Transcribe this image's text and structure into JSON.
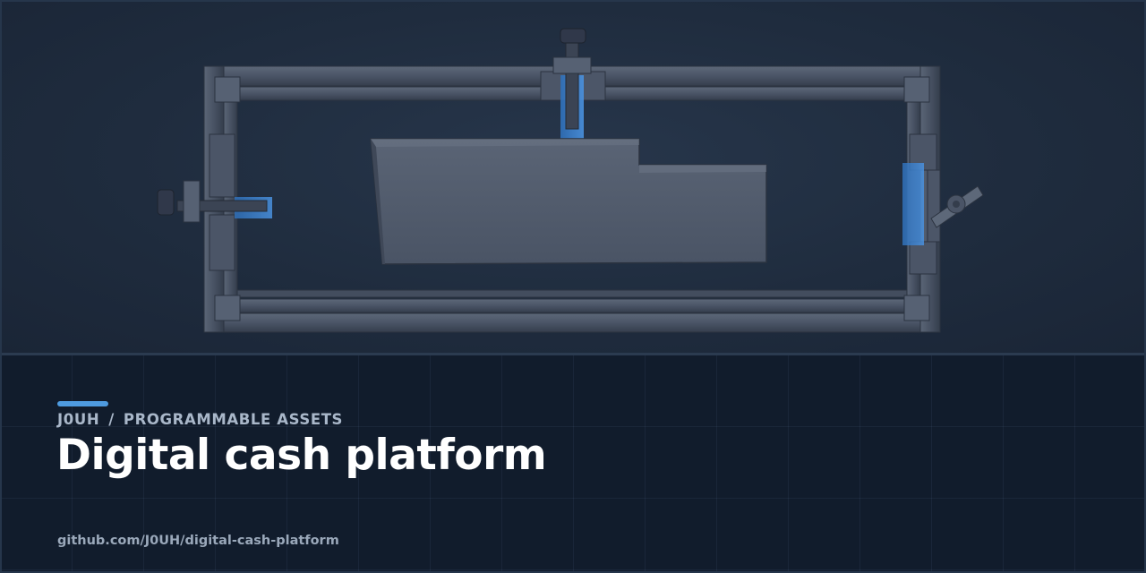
{
  "hero": {
    "illustration": "adjustable-clamp-frame-holding-block",
    "colors": {
      "metal": "#4a5566",
      "highlight": "#4e9be0",
      "background": "#1f2c3e"
    }
  },
  "repo": {
    "owner": "J0UH",
    "separator": "/",
    "topic": "PROGRAMMABLE ASSETS",
    "title": "Digital cash platform",
    "url": "github.com/J0UH/digital-cash-platform"
  },
  "colors": {
    "accent": "#4e9be0",
    "footer_bg": "#111c2c",
    "title": "#ffffff"
  }
}
